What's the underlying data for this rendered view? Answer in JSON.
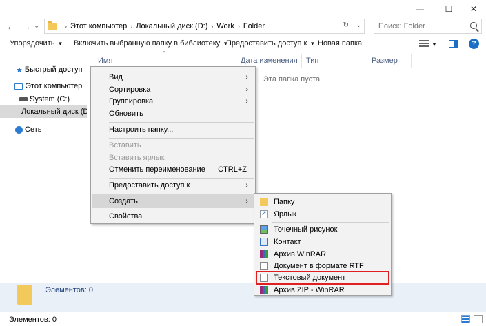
{
  "window": {
    "minimize": "—",
    "maximize": "☐",
    "close": "✕"
  },
  "nav": {
    "back": "←",
    "forward": "→",
    "recent": "⌄",
    "up": "↑"
  },
  "address": {
    "crumbs": [
      "Этот компьютер",
      "Локальный диск (D:)",
      "Work",
      "Folder"
    ],
    "separator": "›"
  },
  "search": {
    "placeholder": "Поиск: Folder"
  },
  "commandbar": {
    "organize": "Упорядочить",
    "include_library": "Включить выбранную папку в библиотеку",
    "share": "Предоставить доступ к",
    "new_folder": "Новая папка",
    "help": "?"
  },
  "navpane": {
    "quick_access": "Быстрый доступ",
    "this_pc": "Этот компьютер",
    "system_c": "System (C:)",
    "local_d": "Локальный диск (D",
    "network": "Сеть"
  },
  "columns": {
    "name": "Имя",
    "date": "Дата изменения",
    "type": "Тип",
    "size": "Размер"
  },
  "empty_message": "Эта папка пуста.",
  "details": {
    "count": "Элементов: 0"
  },
  "status": {
    "count": "Элементов: 0"
  },
  "context_menu": {
    "view": "Вид",
    "sort": "Сортировка",
    "group": "Группировка",
    "refresh": "Обновить",
    "customize": "Настроить папку...",
    "paste": "Вставить",
    "paste_shortcut": "Вставить ярлык",
    "undo_rename": "Отменить переименование",
    "undo_shortcut": "CTRL+Z",
    "share": "Предоставить доступ к",
    "create": "Создать",
    "properties": "Свойства",
    "submenu_arrow": "›"
  },
  "create_submenu": {
    "folder": "Папку",
    "shortcut": "Ярлык",
    "bitmap": "Точечный рисунок",
    "contact": "Контакт",
    "winrar": "Архив WinRAR",
    "rtf": "Документ в формате RTF",
    "text": "Текстовый документ",
    "zip": "Архив ZIP - WinRAR"
  },
  "colors": {
    "highlight_border": "#e02020",
    "details_bg": "#e9f0f8",
    "accent": "#1a6ec4"
  }
}
